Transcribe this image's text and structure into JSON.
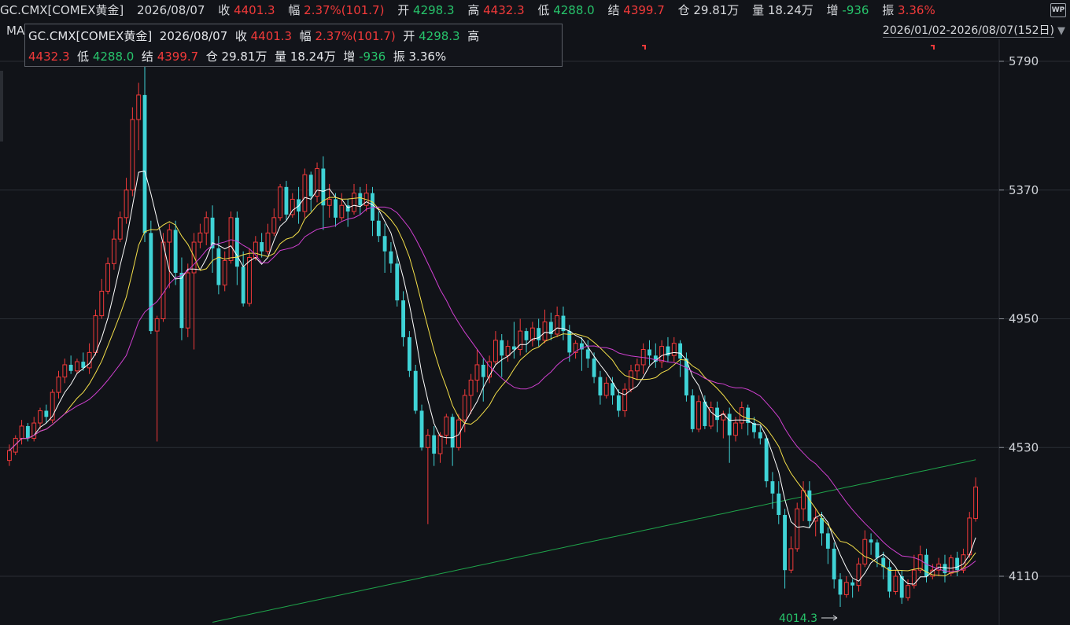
{
  "header": {
    "symbol": "GC.CMX[COMEX黄金]",
    "date": "2026/08/07",
    "close_label": "收",
    "close": "4401.3",
    "change_label": "幅",
    "change": "2.37%(101.7)",
    "open_label": "开",
    "open": "4298.3",
    "high_label": "高",
    "high": "4432.3",
    "low_label": "低",
    "low": "4288.0",
    "settle_label": "结",
    "settle": "4399.7",
    "oi_label": "仓",
    "oi": "29.81万",
    "volume_label": "量",
    "volume": "18.24万",
    "inc_label": "增",
    "inc": "-936",
    "amp_label": "振",
    "amp": "3.36%"
  },
  "corner_icon": "WP",
  "ma_label": "MA",
  "date_range": "2026/01/02-2026/08/07(152日)",
  "colors": {
    "up": "#f23a3a",
    "down": "#3fd3d6",
    "ma5": "#ffffff",
    "ma10": "#f5e04a",
    "ma20": "#d040d0",
    "ma_long": "#1fa34a"
  },
  "chart_data": {
    "type": "candlestick",
    "ylim": [
      3960,
      5890
    ],
    "yticks": [
      5790,
      5370,
      4950,
      4530,
      4110
    ],
    "low_annotation": "4014.3",
    "candles": [
      [
        4488,
        4520,
        4470,
        4540
      ],
      [
        4515,
        4560,
        4505,
        4570
      ],
      [
        4560,
        4600,
        4540,
        4620
      ],
      [
        4600,
        4560,
        4550,
        4610
      ],
      [
        4560,
        4610,
        4550,
        4630
      ],
      [
        4610,
        4650,
        4590,
        4660
      ],
      [
        4650,
        4630,
        4610,
        4670
      ],
      [
        4620,
        4710,
        4610,
        4720
      ],
      [
        4710,
        4760,
        4690,
        4780
      ],
      [
        4760,
        4800,
        4740,
        4820
      ],
      [
        4800,
        4780,
        4770,
        4830
      ],
      [
        4780,
        4810,
        4770,
        4820
      ],
      [
        4810,
        4790,
        4780,
        4840
      ],
      [
        4790,
        4840,
        4770,
        4870
      ],
      [
        4840,
        4960,
        4830,
        4980
      ],
      [
        4960,
        5040,
        4950,
        5080
      ],
      [
        5040,
        5130,
        5030,
        5150
      ],
      [
        5130,
        5210,
        5110,
        5240
      ],
      [
        5210,
        5280,
        5200,
        5300
      ],
      [
        5280,
        5370,
        5260,
        5410
      ],
      [
        5370,
        5600,
        5350,
        5640
      ],
      [
        5600,
        5680,
        5500,
        5720
      ],
      [
        5680,
        5230,
        5200,
        5800
      ],
      [
        5230,
        4910,
        4900,
        5270
      ],
      [
        4910,
        4950,
        4550,
        4960
      ],
      [
        4950,
        5200,
        4940,
        5230
      ],
      [
        5200,
        5240,
        5050,
        5260
      ],
      [
        5240,
        5100,
        5060,
        5270
      ],
      [
        5100,
        4920,
        4880,
        5150
      ],
      [
        4920,
        5100,
        4890,
        5130
      ],
      [
        5100,
        5200,
        4850,
        5230
      ],
      [
        5200,
        5230,
        5180,
        5260
      ],
      [
        5230,
        5280,
        5190,
        5300
      ],
      [
        5280,
        5180,
        5100,
        5320
      ],
      [
        5180,
        5060,
        5030,
        5220
      ],
      [
        5060,
        5140,
        5040,
        5170
      ],
      [
        5140,
        5280,
        5130,
        5300
      ],
      [
        5280,
        5120,
        5060,
        5300
      ],
      [
        5120,
        5000,
        4990,
        5170
      ],
      [
        5000,
        5150,
        4990,
        5180
      ],
      [
        5150,
        5200,
        5140,
        5220
      ],
      [
        5200,
        5170,
        5150,
        5230
      ],
      [
        5170,
        5230,
        5160,
        5260
      ],
      [
        5230,
        5280,
        5220,
        5310
      ],
      [
        5280,
        5380,
        5270,
        5390
      ],
      [
        5380,
        5290,
        5270,
        5400
      ],
      [
        5290,
        5340,
        5280,
        5360
      ],
      [
        5340,
        5300,
        5260,
        5380
      ],
      [
        5300,
        5420,
        5280,
        5440
      ],
      [
        5420,
        5350,
        5300,
        5430
      ],
      [
        5350,
        5440,
        5330,
        5460
      ],
      [
        5440,
        5320,
        5240,
        5480
      ],
      [
        5320,
        5340,
        5280,
        5390
      ],
      [
        5340,
        5280,
        5250,
        5360
      ],
      [
        5280,
        5320,
        5270,
        5360
      ],
      [
        5320,
        5300,
        5250,
        5340
      ],
      [
        5300,
        5360,
        5290,
        5390
      ],
      [
        5360,
        5320,
        5290,
        5380
      ],
      [
        5320,
        5360,
        5300,
        5390
      ],
      [
        5360,
        5270,
        5220,
        5380
      ],
      [
        5270,
        5220,
        5200,
        5300
      ],
      [
        5220,
        5170,
        5100,
        5260
      ],
      [
        5170,
        5130,
        5100,
        5200
      ],
      [
        5130,
        5010,
        4990,
        5160
      ],
      [
        5010,
        4890,
        4860,
        5040
      ],
      [
        4890,
        4780,
        4760,
        4910
      ],
      [
        4780,
        4650,
        4640,
        4800
      ],
      [
        4650,
        4530,
        4520,
        4670
      ],
      [
        4530,
        4570,
        4280,
        4590
      ],
      [
        4570,
        4510,
        4470,
        4600
      ],
      [
        4510,
        4570,
        4480,
        4580
      ],
      [
        4570,
        4630,
        4540,
        4640
      ],
      [
        4630,
        4530,
        4470,
        4640
      ],
      [
        4530,
        4620,
        4520,
        4640
      ],
      [
        4620,
        4700,
        4580,
        4720
      ],
      [
        4700,
        4750,
        4640,
        4770
      ],
      [
        4750,
        4800,
        4710,
        4850
      ],
      [
        4800,
        4760,
        4680,
        4820
      ],
      [
        4760,
        4810,
        4740,
        4830
      ],
      [
        4810,
        4880,
        4800,
        4910
      ],
      [
        4880,
        4830,
        4760,
        4900
      ],
      [
        4830,
        4860,
        4810,
        4880
      ],
      [
        4860,
        4850,
        4820,
        4940
      ],
      [
        4850,
        4910,
        4830,
        4950
      ],
      [
        4910,
        4880,
        4840,
        4920
      ],
      [
        4880,
        4920,
        4860,
        4940
      ],
      [
        4920,
        4880,
        4860,
        4950
      ],
      [
        4880,
        4940,
        4870,
        4980
      ],
      [
        4940,
        4900,
        4880,
        4970
      ],
      [
        4900,
        4960,
        4890,
        4990
      ],
      [
        4960,
        4910,
        4880,
        4990
      ],
      [
        4910,
        4840,
        4810,
        4930
      ],
      [
        4840,
        4870,
        4820,
        4880
      ],
      [
        4870,
        4850,
        4780,
        4890
      ],
      [
        4850,
        4820,
        4790,
        4880
      ],
      [
        4820,
        4760,
        4740,
        4840
      ],
      [
        4760,
        4700,
        4670,
        4780
      ],
      [
        4700,
        4740,
        4690,
        4760
      ],
      [
        4740,
        4700,
        4670,
        4760
      ],
      [
        4700,
        4650,
        4630,
        4720
      ],
      [
        4650,
        4720,
        4630,
        4740
      ],
      [
        4720,
        4780,
        4710,
        4800
      ],
      [
        4780,
        4800,
        4750,
        4820
      ],
      [
        4800,
        4850,
        4770,
        4870
      ],
      [
        4850,
        4830,
        4800,
        4880
      ],
      [
        4830,
        4810,
        4790,
        4870
      ],
      [
        4810,
        4860,
        4790,
        4880
      ],
      [
        4860,
        4830,
        4810,
        4890
      ],
      [
        4830,
        4870,
        4810,
        4890
      ],
      [
        4870,
        4820,
        4760,
        4880
      ],
      [
        4820,
        4700,
        4680,
        4840
      ],
      [
        4700,
        4590,
        4580,
        4720
      ],
      [
        4590,
        4680,
        4580,
        4700
      ],
      [
        4680,
        4600,
        4590,
        4700
      ],
      [
        4600,
        4660,
        4590,
        4680
      ],
      [
        4660,
        4620,
        4580,
        4680
      ],
      [
        4620,
        4640,
        4560,
        4650
      ],
      [
        4640,
        4570,
        4480,
        4660
      ],
      [
        4570,
        4610,
        4550,
        4630
      ],
      [
        4610,
        4660,
        4590,
        4680
      ],
      [
        4660,
        4610,
        4570,
        4670
      ],
      [
        4610,
        4580,
        4560,
        4630
      ],
      [
        4580,
        4560,
        4540,
        4600
      ],
      [
        4560,
        4420,
        4400,
        4570
      ],
      [
        4420,
        4380,
        4330,
        4450
      ],
      [
        4380,
        4310,
        4280,
        4420
      ],
      [
        4310,
        4130,
        4070,
        4330
      ],
      [
        4130,
        4200,
        4120,
        4240
      ],
      [
        4200,
        4330,
        4190,
        4350
      ],
      [
        4330,
        4390,
        4290,
        4420
      ],
      [
        4390,
        4290,
        4270,
        4420
      ],
      [
        4290,
        4300,
        4240,
        4330
      ],
      [
        4300,
        4250,
        4210,
        4320
      ],
      [
        4250,
        4200,
        4150,
        4270
      ],
      [
        4200,
        4100,
        4070,
        4220
      ],
      [
        4100,
        4050,
        4010,
        4120
      ],
      [
        4050,
        4090,
        4040,
        4110
      ],
      [
        4090,
        4080,
        4040,
        4100
      ],
      [
        4080,
        4150,
        4060,
        4170
      ],
      [
        4150,
        4230,
        4140,
        4260
      ],
      [
        4230,
        4220,
        4180,
        4250
      ],
      [
        4220,
        4170,
        4140,
        4230
      ],
      [
        4170,
        4140,
        4100,
        4190
      ],
      [
        4140,
        4060,
        4040,
        4160
      ],
      [
        4060,
        4110,
        4050,
        4130
      ],
      [
        4110,
        4040,
        4020,
        4130
      ],
      [
        4040,
        4080,
        4030,
        4100
      ],
      [
        4080,
        4130,
        4070,
        4180
      ],
      [
        4130,
        4180,
        4120,
        4210
      ],
      [
        4180,
        4110,
        4090,
        4200
      ],
      [
        4110,
        4130,
        4100,
        4150
      ],
      [
        4130,
        4150,
        4110,
        4170
      ],
      [
        4150,
        4120,
        4090,
        4180
      ],
      [
        4120,
        4170,
        4110,
        4180
      ],
      [
        4170,
        4130,
        4110,
        4190
      ],
      [
        4130,
        4180,
        4120,
        4200
      ],
      [
        4180,
        4300,
        4170,
        4320
      ],
      [
        4298.3,
        4401.3,
        4288.0,
        4432.3
      ]
    ]
  }
}
